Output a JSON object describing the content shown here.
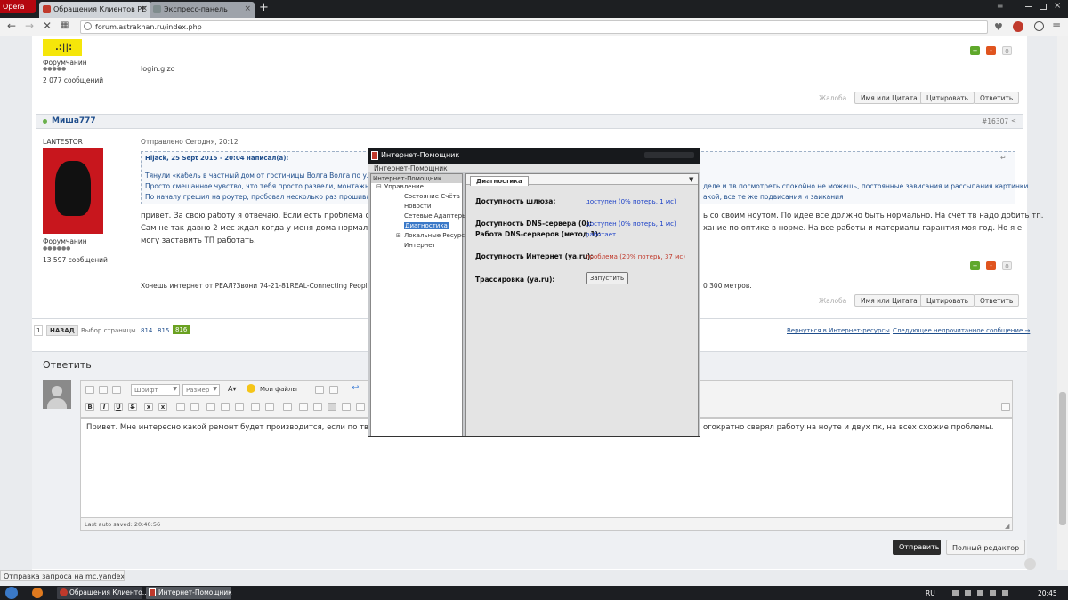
{
  "browser": {
    "opera_label": "Opera",
    "tabs": [
      {
        "label": "Обращения Клиентов РЕ",
        "fav_color": "#c0392b"
      },
      {
        "label": "Экспресс-панель",
        "fav_color": "#7f8c8d"
      }
    ],
    "url": "forum.astrakhan.ru/index.php"
  },
  "post1": {
    "rank": "Форумчанин",
    "stars": "●●●●●",
    "count": "2 077 сообщений",
    "body": "login:gizo"
  },
  "post_actions": {
    "complain": "Жалоба",
    "name_quote": "Имя или Цитата",
    "quote": "Цитировать",
    "reply": "Ответить"
  },
  "vote": {
    "up": "+",
    "down": "-",
    "score": "0"
  },
  "post2": {
    "author": "Миша777",
    "number": "#16307",
    "status": "LANTESTOR",
    "sent": "Отправлено Сегодня, 20:12",
    "quote_head": "Hijack, 25 Sept 2015 - 20:04 написал(а):",
    "quote_lines": [
      "Тянули «кабель в частный дом от гостиницы Волга Волга по ул. М",
      "Просто смешанное чувство, что тебя просто развели, монтажник",
      "По началу грешил на роутер, пробовал несколько раз прошивать"
    ],
    "quote_right": [
      "деле и тв посмотреть спокойно не можешь, постоянные зависания и рассыпания картинки.",
      "акой, все те же подвисания и заикания"
    ],
    "body_lines": [
      "привет. За свою работу я отвечаю. Если есть проблема с тв о",
      " Сам не так давно 2 мес ждал когда у меня дома нормально б",
      "могу заставить ТП работать."
    ],
    "body_right": [
      "ь со своим ноутом. По идее все должно быть нормально. На счет тв надо добить тп.",
      "хание по оптике в норме. На все работы и материалы гарантия моя  год.   Но я е"
    ],
    "rank": "Форумчанин",
    "stars": "●●●●●●",
    "count": "13 597 сообщений",
    "signature": "Хочешь интернет от РЕАЛ?Звони 74-21-81REAL-Connecting People",
    "signature_right": "0 300 метров."
  },
  "pagination": {
    "first": "1",
    "back": "НАЗАД",
    "choose": "Выбор страницы",
    "pages": [
      "814",
      "815"
    ],
    "current": "816",
    "back_link": "Вернуться в Интернет-ресурсы",
    "next_link": "Следующее непрочитанное сообщение →"
  },
  "reply": {
    "title": "Ответить",
    "font": "Шрифт",
    "size": "Размер",
    "my_files": "Мои файлы",
    "text": "Привет. Мне интересно какой ремонт будет производится, если по твоим сл",
    "text_right": "огократно сверял работу на ноуте и двух пк, на всех схожие проблемы.",
    "autosave": "Last auto saved: 20:40:56",
    "send": "Отправить",
    "full_editor": "Полный редактор"
  },
  "dialog": {
    "title": "Интернет-Помощник",
    "menu": "Интернет-Помощник",
    "tree_header": "Интернет-Помощник",
    "tree": [
      {
        "label": "Управление",
        "level": 0,
        "prefix": "⊟"
      },
      {
        "label": "Состояние Счёта",
        "level": 1,
        "prefix": ""
      },
      {
        "label": "Новости",
        "level": 1,
        "prefix": ""
      },
      {
        "label": "Сетевые Адаптеры",
        "level": 1,
        "prefix": ""
      },
      {
        "label": "Диагностика",
        "level": 1,
        "prefix": "",
        "selected": true
      },
      {
        "label": "Локальные Ресурсы",
        "level": 1,
        "prefix": "⊞"
      },
      {
        "label": "Интернет",
        "level": 1,
        "prefix": ""
      }
    ],
    "tab": "Диагностика",
    "rows": [
      {
        "label": "Доступность шлюза:",
        "value": "доступен (0% потерь, 1 мс)",
        "color": "#1a3fc7"
      },
      {
        "label": "Доступность DNS-сервера (0):",
        "value": "доступен (0% потерь, 1 мс)",
        "color": "#1a3fc7"
      },
      {
        "label": "Работа DNS-серверов (метод 1):",
        "value": "работает",
        "color": "#1a3fc7"
      },
      {
        "label": "Доступность Интернет (ya.ru):",
        "value": "проблема (20% потерь, 37 мс)",
        "color": "#c0392b"
      },
      {
        "label": "Трассировка (ya.ru):",
        "value": "",
        "color": "#333"
      }
    ],
    "run_button": "Запустить"
  },
  "status_bar": "Отправка запроса на mc.yandex.ru...",
  "taskbar": {
    "items": [
      "Обращения Клиенто...",
      "Интернет-Помощник"
    ],
    "lang": "RU",
    "clock": "20:45"
  }
}
